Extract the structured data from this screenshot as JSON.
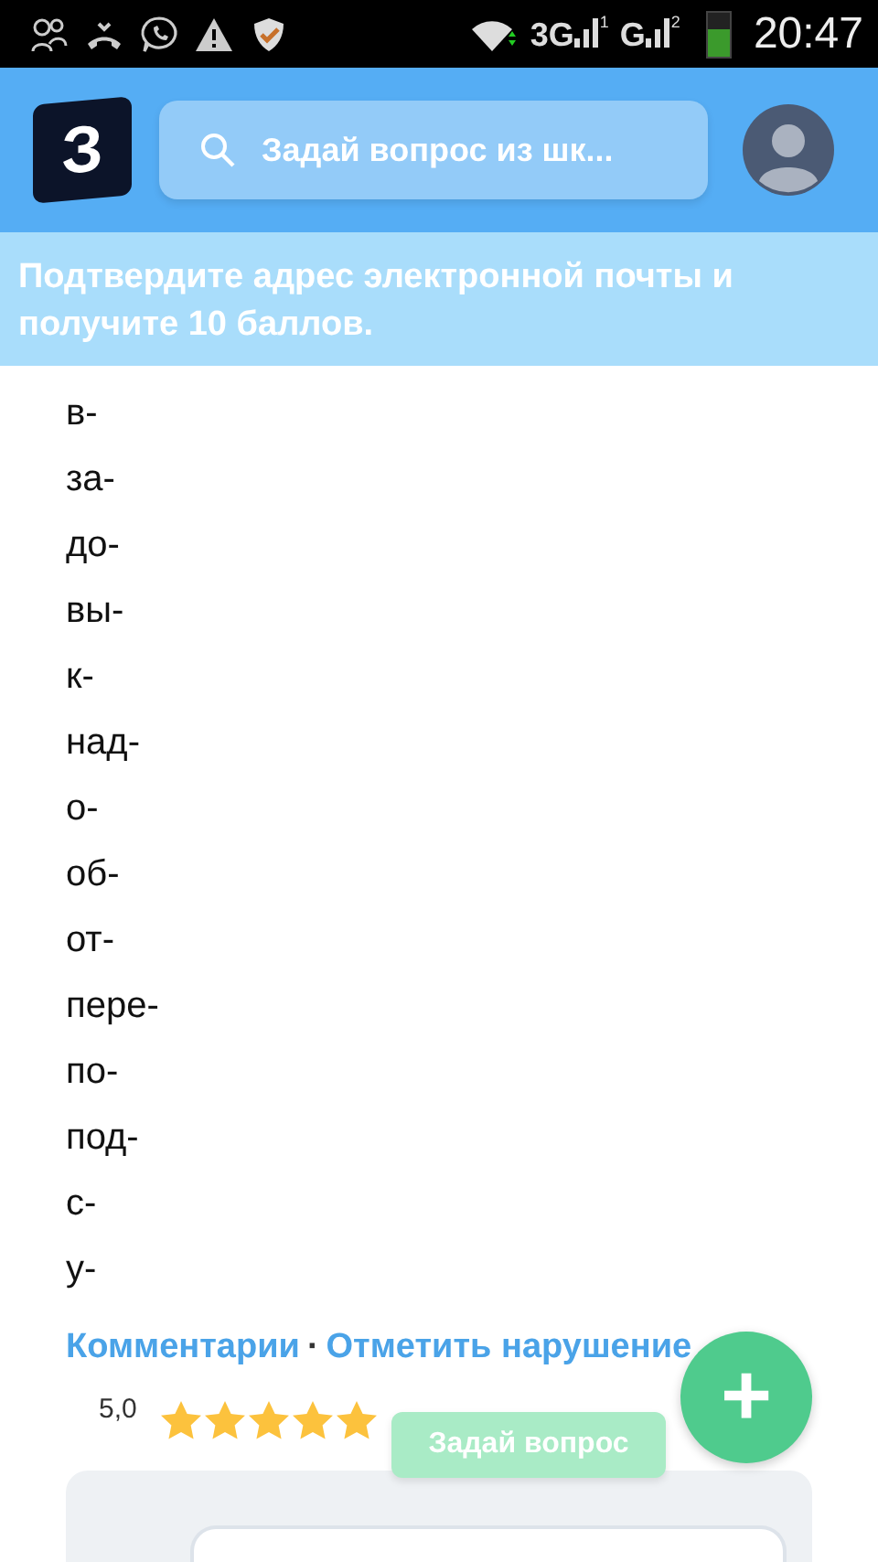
{
  "status_bar": {
    "networks": [
      {
        "label": "3G",
        "sim": "1"
      },
      {
        "label": "G",
        "sim": "2"
      }
    ],
    "time": "20:47"
  },
  "header": {
    "logo": "З",
    "search": {
      "placeholder": "Задай вопрос из шк..."
    }
  },
  "banner": "Подтвердите адрес электронной почты и получите 10 баллов.",
  "answer_lines": [
    "в-",
    "за-",
    "до-",
    "вы-",
    "к-",
    "над-",
    "о-",
    "об-",
    "от-",
    "пере-",
    "по-",
    "под-",
    "с-",
    "у-"
  ],
  "links": [
    {
      "label": "Комментарии"
    },
    {
      "label": "Отметить нарушение"
    }
  ],
  "link_separator": "·",
  "rating": {
    "value": "5,0",
    "stars": 5
  },
  "ask_button": "Задай вопрос",
  "fab": "+"
}
